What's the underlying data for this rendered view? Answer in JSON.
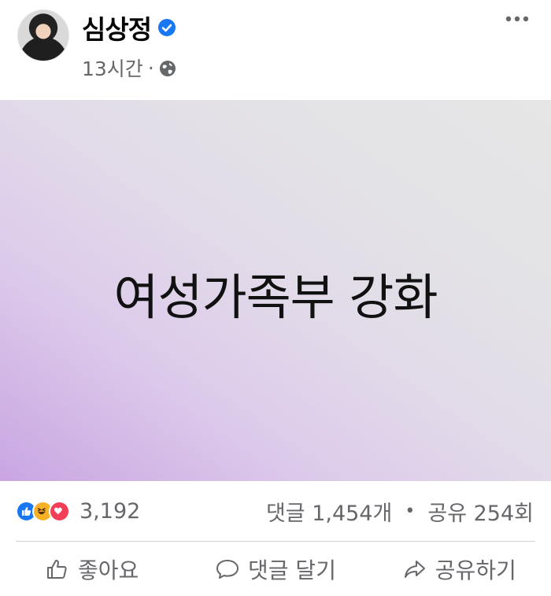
{
  "post": {
    "author": "심상정",
    "time": "13시간",
    "separator": "·",
    "image_text": "여성가족부 강화"
  },
  "stats": {
    "reaction_count": "3,192",
    "comments": "댓글 1,454개",
    "bullet": "•",
    "shares": "공유 254회",
    "reactions": [
      "like",
      "haha",
      "love"
    ]
  },
  "actions": {
    "like_label": "좋아요",
    "comment_label": "댓글 달기",
    "share_label": "공유하기"
  },
  "colors": {
    "verified": "#1877f2",
    "like": "#1877f2",
    "haha": "#f7b125",
    "love": "#f33e58",
    "secondary_text": "#65676b"
  }
}
